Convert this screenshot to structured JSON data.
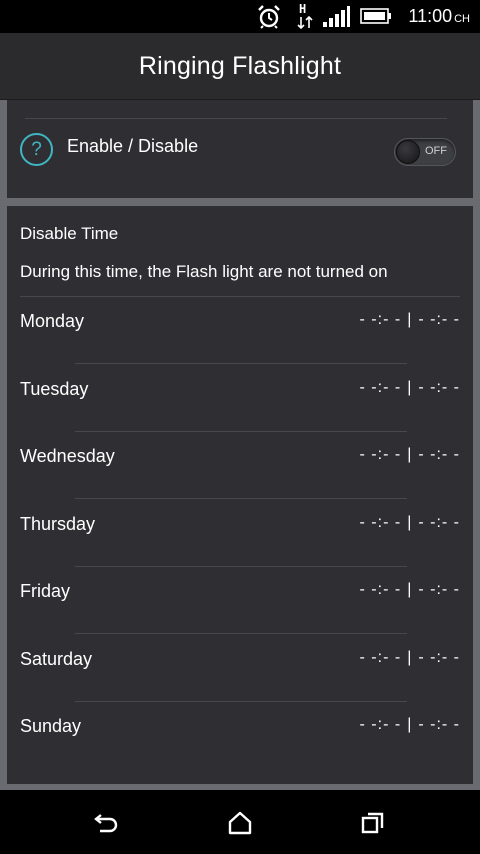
{
  "status_bar": {
    "time": "11:00",
    "time_suffix": "CH",
    "network": "H",
    "icons": [
      "alarm-clock-icon",
      "network-h-icon",
      "signal-icon",
      "battery-icon"
    ]
  },
  "app_bar": {
    "title": "Ringing Flashlight"
  },
  "enable_card": {
    "help_glyph": "?",
    "label": "Enable / Disable",
    "toggle_label": "OFF",
    "toggle_on": false
  },
  "disable_time": {
    "heading": "Disable Time",
    "description": "During this time, the Flash light are not turned on",
    "days": [
      {
        "name": "Monday",
        "start": "- -:- -",
        "end": "- -:- -"
      },
      {
        "name": "Tuesday",
        "start": "- -:- -",
        "end": "- -:- -"
      },
      {
        "name": "Wednesday",
        "start": "- -:- -",
        "end": "- -:- -"
      },
      {
        "name": "Thursday",
        "start": "- -:- -",
        "end": "- -:- -"
      },
      {
        "name": "Friday",
        "start": "- -:- -",
        "end": "- -:- -"
      },
      {
        "name": "Saturday",
        "start": "- -:- -",
        "end": "- -:- -"
      },
      {
        "name": "Sunday",
        "start": "- -:- -",
        "end": "- -:- -"
      }
    ],
    "separator": "|"
  },
  "nav_bar": {
    "icons": [
      "back-icon",
      "home-icon",
      "recent-apps-icon"
    ]
  },
  "colors": {
    "accent": "#3fb6c2",
    "card": "#2f2f33",
    "background": "#6a6b70",
    "app_bar": "#2b2b2d"
  }
}
